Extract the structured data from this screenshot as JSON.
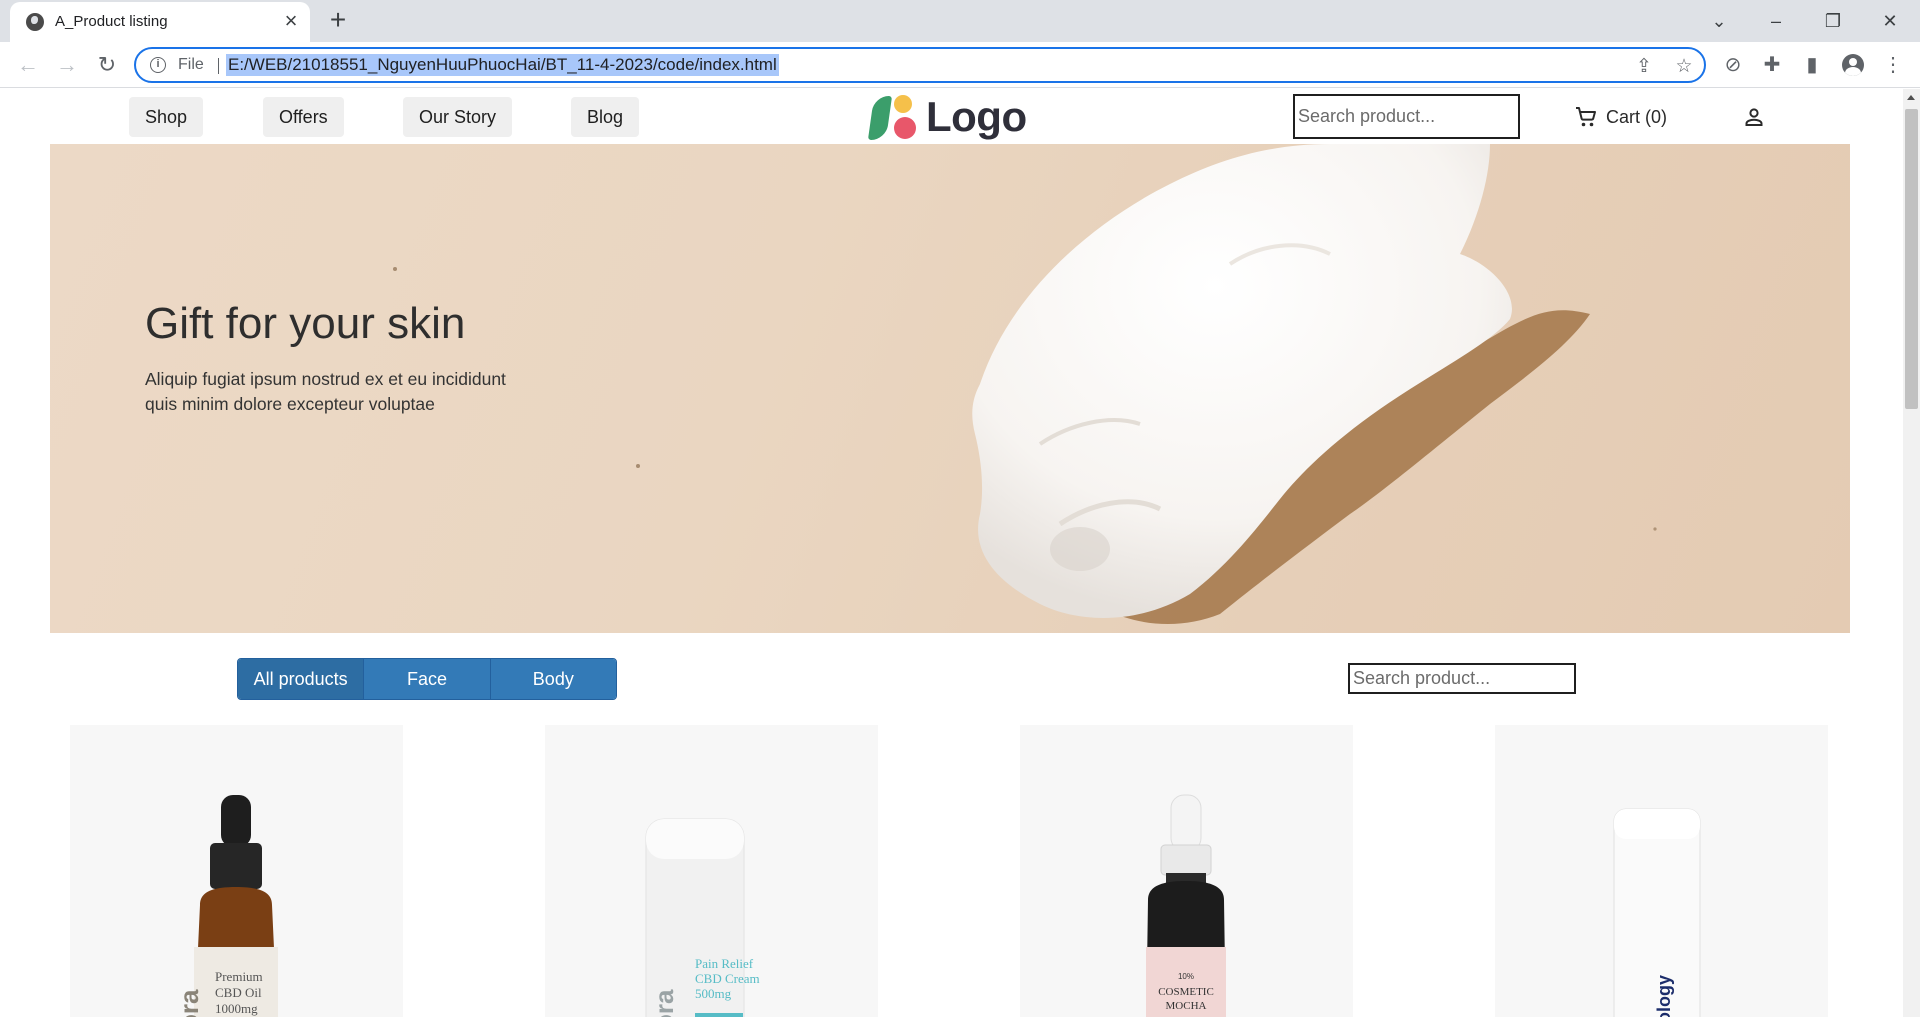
{
  "browser": {
    "tab_title": "A_Product listing",
    "scheme_label": "File",
    "url": "E:/WEB/21018551_NguyenHuuPhuocHai/BT_11-4-2023/code/index.html"
  },
  "site": {
    "nav": [
      {
        "label": "Shop"
      },
      {
        "label": "Offers"
      },
      {
        "label": "Our Story"
      },
      {
        "label": "Blog"
      }
    ],
    "logo_text": "Logo",
    "search_placeholder": "Search product...",
    "cart_label": "Cart (0)"
  },
  "hero": {
    "title": "Gift for your skin",
    "text": "Aliquip fugiat ipsum nostrud ex et eu incididunt quis minim dolore excepteur voluptae"
  },
  "filters": {
    "buttons": [
      {
        "label": "All products",
        "active": true
      },
      {
        "label": "Face",
        "active": false
      },
      {
        "label": "Body",
        "active": false
      }
    ],
    "search_placeholder": "Search product..."
  },
  "products": [
    {
      "label_lines": [
        "Premium",
        "CBD Oil",
        "1000mg"
      ],
      "side_text": "ora"
    },
    {
      "label_lines": [
        "Pain Relief",
        "CBD Cream",
        "500mg"
      ],
      "side_text": "ora"
    },
    {
      "label_lines": [
        "10%",
        "COSMETIC",
        "MOCHA"
      ],
      "side_text": ""
    },
    {
      "label_lines": [
        "rology"
      ],
      "side_text": ""
    }
  ],
  "colors": {
    "filter_button": "#337ab7",
    "omnibox_focus": "#1a73e8",
    "logo_green": "#3b9e6b",
    "logo_yellow": "#f5c04a",
    "logo_pink": "#e8576a"
  }
}
